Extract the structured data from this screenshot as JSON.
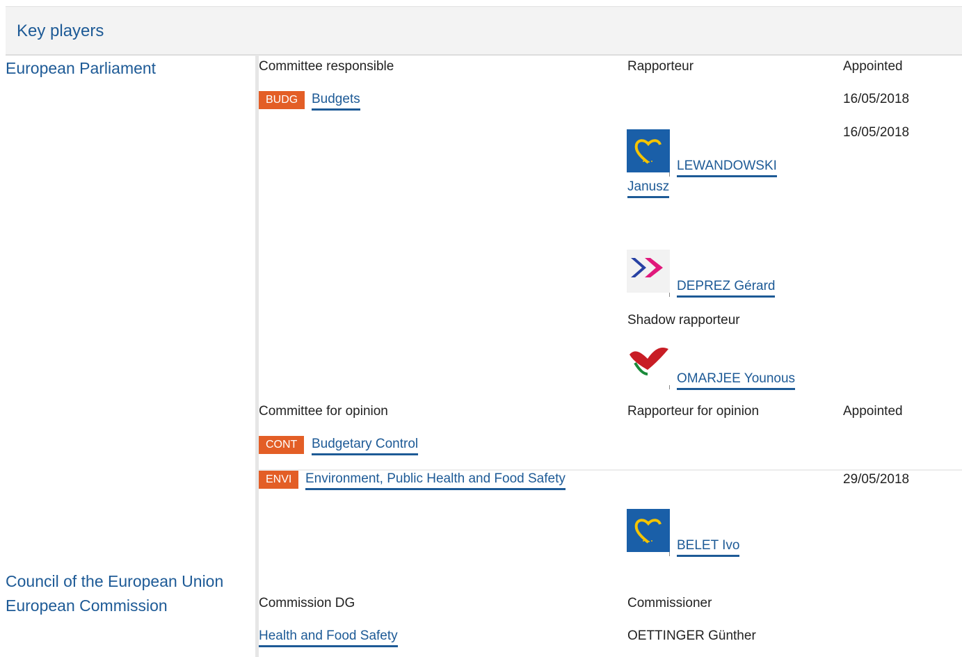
{
  "header": {
    "title": "Key players"
  },
  "institutions": {
    "parliament": "European Parliament",
    "council": "Council of the European Union",
    "commission": "European Commission"
  },
  "responsible": {
    "col_committee": "Committee responsible",
    "col_rapporteur": "Rapporteur",
    "col_appointed": "Appointed",
    "committee_abbr": "BUDG",
    "committee_name": "Budgets",
    "committee_date": "16/05/2018",
    "rapporteur_date": "16/05/2018",
    "rapporteurs": [
      {
        "name": "LEWANDOWSKI Janusz",
        "name_line1": "LEWANDOWSKI",
        "name_line2": "Janusz",
        "icon": "epp-group-icon"
      },
      {
        "name": "DEPREZ Gérard",
        "icon": "alde-group-icon"
      }
    ],
    "shadow_label": "Shadow rapporteur",
    "shadow_rapporteurs": [
      {
        "name": "OMARJEE Younous",
        "icon": "gue-group-icon"
      }
    ]
  },
  "opinion": {
    "col_committee": "Committee for opinion",
    "col_rapporteur": "Rapporteur for opinion",
    "col_appointed": "Appointed",
    "committees": [
      {
        "abbr": "CONT",
        "name": "Budgetary Control"
      },
      {
        "abbr": "ENVI",
        "name": "Environment, Public Health and Food Safety",
        "date": "29/05/2018",
        "rapporteur": "BELET Ivo",
        "icon": "epp-group-icon"
      }
    ]
  },
  "commission": {
    "col_dg": "Commission DG",
    "col_commissioner": "Commissioner",
    "dg": "Health and Food Safety",
    "commissioner": "OETTINGER Günther"
  },
  "colors": {
    "link": "#1d5a96",
    "badge": "#e35e26",
    "header_bg": "#f3f3f3"
  }
}
